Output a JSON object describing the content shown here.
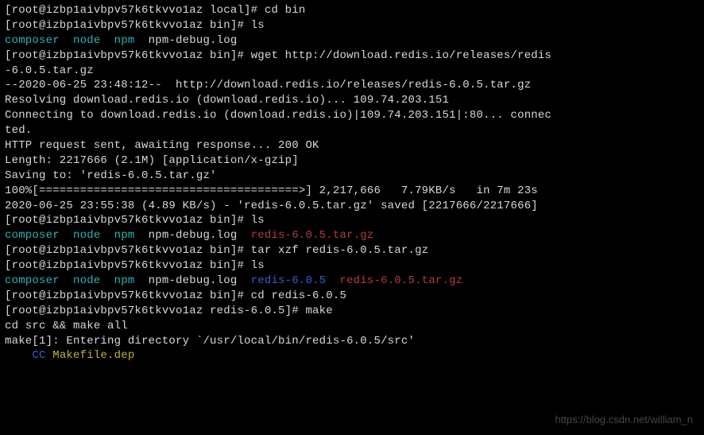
{
  "lines": [
    {
      "segments": [
        {
          "class": "prompt",
          "text": "[root@izbp1aivbpv57k6tkvvo1az local]# cd bin"
        }
      ]
    },
    {
      "segments": [
        {
          "class": "prompt",
          "text": "[root@izbp1aivbpv57k6tkvvo1az bin]# ls"
        }
      ]
    },
    {
      "segments": [
        {
          "class": "cyan",
          "text": "composer"
        },
        {
          "class": "white",
          "text": "  "
        },
        {
          "class": "cyan",
          "text": "node"
        },
        {
          "class": "white",
          "text": "  "
        },
        {
          "class": "cyan",
          "text": "npm"
        },
        {
          "class": "white",
          "text": "  npm-debug.log"
        }
      ]
    },
    {
      "segments": [
        {
          "class": "prompt",
          "text": "[root@izbp1aivbpv57k6tkvvo1az bin]# wget http://download.redis.io/releases/redis"
        }
      ]
    },
    {
      "segments": [
        {
          "class": "prompt",
          "text": "-6.0.5.tar.gz"
        }
      ]
    },
    {
      "segments": [
        {
          "class": "white",
          "text": "--2020-06-25 23:48:12--  http://download.redis.io/releases/redis-6.0.5.tar.gz"
        }
      ]
    },
    {
      "segments": [
        {
          "class": "white",
          "text": "Resolving download.redis.io (download.redis.io)... 109.74.203.151"
        }
      ]
    },
    {
      "segments": [
        {
          "class": "white",
          "text": "Connecting to download.redis.io (download.redis.io)|109.74.203.151|:80... connec"
        }
      ]
    },
    {
      "segments": [
        {
          "class": "white",
          "text": "ted."
        }
      ]
    },
    {
      "segments": [
        {
          "class": "white",
          "text": "HTTP request sent, awaiting response... 200 OK"
        }
      ]
    },
    {
      "segments": [
        {
          "class": "white",
          "text": "Length: 2217666 (2.1M) [application/x-gzip]"
        }
      ]
    },
    {
      "segments": [
        {
          "class": "white",
          "text": "Saving to: 'redis-6.0.5.tar.gz'"
        }
      ]
    },
    {
      "segments": [
        {
          "class": "white",
          "text": ""
        }
      ]
    },
    {
      "segments": [
        {
          "class": "white",
          "text": "100%[======================================>] 2,217,666   7.79KB/s   in 7m 23s"
        }
      ]
    },
    {
      "segments": [
        {
          "class": "white",
          "text": ""
        }
      ]
    },
    {
      "segments": [
        {
          "class": "white",
          "text": "2020-06-25 23:55:38 (4.89 KB/s) - 'redis-6.0.5.tar.gz' saved [2217666/2217666]"
        }
      ]
    },
    {
      "segments": [
        {
          "class": "white",
          "text": ""
        }
      ]
    },
    {
      "segments": [
        {
          "class": "prompt",
          "text": "[root@izbp1aivbpv57k6tkvvo1az bin]# ls"
        }
      ]
    },
    {
      "segments": [
        {
          "class": "cyan",
          "text": "composer"
        },
        {
          "class": "white",
          "text": "  "
        },
        {
          "class": "cyan",
          "text": "node"
        },
        {
          "class": "white",
          "text": "  "
        },
        {
          "class": "cyan",
          "text": "npm"
        },
        {
          "class": "white",
          "text": "  npm-debug.log  "
        },
        {
          "class": "red",
          "text": "redis-6.0.5.tar.gz"
        }
      ]
    },
    {
      "segments": [
        {
          "class": "prompt",
          "text": "[root@izbp1aivbpv57k6tkvvo1az bin]# tar xzf redis-6.0.5.tar.gz"
        }
      ]
    },
    {
      "segments": [
        {
          "class": "prompt",
          "text": "[root@izbp1aivbpv57k6tkvvo1az bin]# ls"
        }
      ]
    },
    {
      "segments": [
        {
          "class": "cyan",
          "text": "composer"
        },
        {
          "class": "white",
          "text": "  "
        },
        {
          "class": "cyan",
          "text": "node"
        },
        {
          "class": "white",
          "text": "  "
        },
        {
          "class": "cyan",
          "text": "npm"
        },
        {
          "class": "white",
          "text": "  npm-debug.log  "
        },
        {
          "class": "blue",
          "text": "redis-6.0.5"
        },
        {
          "class": "white",
          "text": "  "
        },
        {
          "class": "red",
          "text": "redis-6.0.5.tar.gz"
        }
      ]
    },
    {
      "segments": [
        {
          "class": "prompt",
          "text": "[root@izbp1aivbpv57k6tkvvo1az bin]# cd redis-6.0.5"
        }
      ]
    },
    {
      "segments": [
        {
          "class": "prompt",
          "text": "[root@izbp1aivbpv57k6tkvvo1az redis-6.0.5]# make"
        }
      ]
    },
    {
      "segments": [
        {
          "class": "white",
          "text": "cd src && make all"
        }
      ]
    },
    {
      "segments": [
        {
          "class": "white",
          "text": "make[1]: Entering directory `/usr/local/bin/redis-6.0.5/src'"
        }
      ]
    },
    {
      "segments": [
        {
          "class": "white",
          "text": "    "
        },
        {
          "class": "blue",
          "text": "CC"
        },
        {
          "class": "white",
          "text": " "
        },
        {
          "class": "yellow",
          "text": "Makefile.dep"
        }
      ]
    }
  ],
  "watermark": "https://blog.csdn.net/william_n"
}
